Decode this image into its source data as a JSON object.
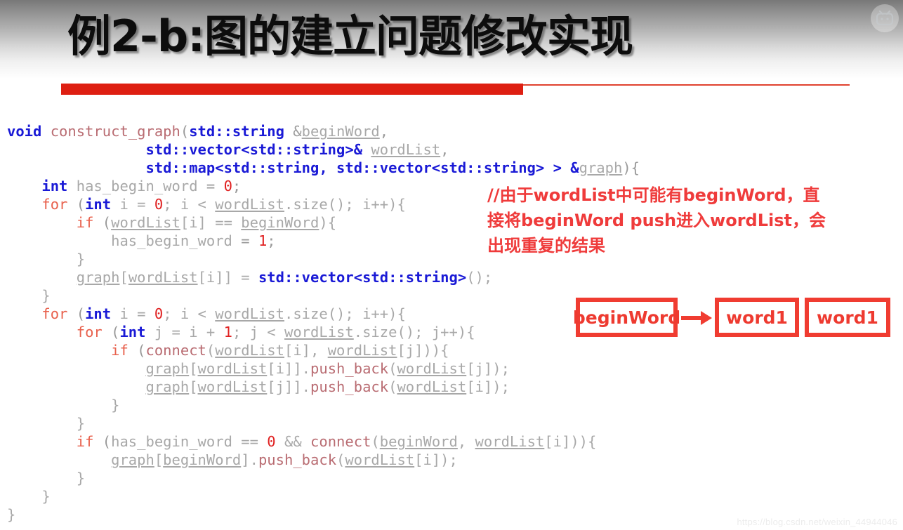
{
  "slide": {
    "title": "例2-b:图的建立问题修改实现",
    "watermark": "https://blog.csdn.net/weixin_44944046",
    "logo_icon": "bilibili-tv-logo-icon",
    "accent_color": "#de1f12",
    "annotation_color": "#ef3b3b",
    "keyword_color": "#1a1ad6"
  },
  "code": {
    "language": "cpp",
    "lines": [
      {
        "indent": 0,
        "tokens": [
          {
            "t": "void",
            "c": "kw"
          },
          {
            "t": " ",
            "c": "punc"
          },
          {
            "t": "construct_graph",
            "c": "fn"
          },
          {
            "t": "(",
            "c": "punc"
          },
          {
            "t": "std::string",
            "c": "kw"
          },
          {
            "t": " &",
            "c": "punc"
          },
          {
            "t": "beginWord",
            "c": "var"
          },
          {
            "t": ",",
            "c": "punc"
          }
        ]
      },
      {
        "indent": 8,
        "tokens": [
          {
            "t": "std::vector",
            "c": "kw"
          },
          {
            "t": "<",
            "c": "kw"
          },
          {
            "t": "std::string",
            "c": "kw"
          },
          {
            "t": ">& ",
            "c": "kw"
          },
          {
            "t": "wordList",
            "c": "var"
          },
          {
            "t": ",",
            "c": "punc"
          }
        ]
      },
      {
        "indent": 8,
        "tokens": [
          {
            "t": "std::map",
            "c": "kw"
          },
          {
            "t": "<",
            "c": "kw"
          },
          {
            "t": "std::string",
            "c": "kw"
          },
          {
            "t": ", ",
            "c": "kw"
          },
          {
            "t": "std::vector",
            "c": "kw"
          },
          {
            "t": "<",
            "c": "kw"
          },
          {
            "t": "std::string",
            "c": "kw"
          },
          {
            "t": "> > &",
            "c": "kw"
          },
          {
            "t": "graph",
            "c": "var"
          },
          {
            "t": "){",
            "c": "punc"
          }
        ]
      },
      {
        "indent": 2,
        "tokens": [
          {
            "t": "int",
            "c": "kw"
          },
          {
            "t": " ",
            "c": "punc"
          },
          {
            "t": "has_begin_word",
            "c": "id"
          },
          {
            "t": " = ",
            "c": "punc"
          },
          {
            "t": "0",
            "c": "num"
          },
          {
            "t": ";",
            "c": "punc"
          }
        ]
      },
      {
        "indent": 2,
        "tokens": [
          {
            "t": "for",
            "c": "ctl"
          },
          {
            "t": " (",
            "c": "punc"
          },
          {
            "t": "int",
            "c": "kw"
          },
          {
            "t": " i = ",
            "c": "id"
          },
          {
            "t": "0",
            "c": "num"
          },
          {
            "t": "; i < ",
            "c": "id"
          },
          {
            "t": "wordList",
            "c": "var"
          },
          {
            "t": ".size(); i++){",
            "c": "id"
          }
        ]
      },
      {
        "indent": 4,
        "tokens": [
          {
            "t": "if",
            "c": "ctl"
          },
          {
            "t": " (",
            "c": "punc"
          },
          {
            "t": "wordList",
            "c": "var"
          },
          {
            "t": "[i] == ",
            "c": "id"
          },
          {
            "t": "beginWord",
            "c": "var"
          },
          {
            "t": "){",
            "c": "id"
          }
        ]
      },
      {
        "indent": 6,
        "tokens": [
          {
            "t": "has_begin_word",
            "c": "id"
          },
          {
            "t": " = ",
            "c": "punc"
          },
          {
            "t": "1",
            "c": "num"
          },
          {
            "t": ";",
            "c": "punc"
          }
        ]
      },
      {
        "indent": 4,
        "tokens": [
          {
            "t": "}",
            "c": "id"
          }
        ]
      },
      {
        "indent": 4,
        "tokens": [
          {
            "t": "graph",
            "c": "var"
          },
          {
            "t": "[",
            "c": "id"
          },
          {
            "t": "wordList",
            "c": "var"
          },
          {
            "t": "[i]] = ",
            "c": "id"
          },
          {
            "t": "std::vector",
            "c": "kw"
          },
          {
            "t": "<",
            "c": "kw"
          },
          {
            "t": "std::string",
            "c": "kw"
          },
          {
            "t": ">",
            "c": "kw"
          },
          {
            "t": "();",
            "c": "id"
          }
        ]
      },
      {
        "indent": 2,
        "tokens": [
          {
            "t": "}",
            "c": "id"
          }
        ]
      },
      {
        "indent": 2,
        "tokens": [
          {
            "t": "for",
            "c": "ctl"
          },
          {
            "t": " (",
            "c": "punc"
          },
          {
            "t": "int",
            "c": "kw"
          },
          {
            "t": " i = ",
            "c": "id"
          },
          {
            "t": "0",
            "c": "num"
          },
          {
            "t": "; i < ",
            "c": "id"
          },
          {
            "t": "wordList",
            "c": "var"
          },
          {
            "t": ".size(); i++){",
            "c": "id"
          }
        ]
      },
      {
        "indent": 4,
        "tokens": [
          {
            "t": "for",
            "c": "ctl"
          },
          {
            "t": " (",
            "c": "punc"
          },
          {
            "t": "int",
            "c": "kw"
          },
          {
            "t": " j = i + ",
            "c": "id"
          },
          {
            "t": "1",
            "c": "num"
          },
          {
            "t": "; j < ",
            "c": "id"
          },
          {
            "t": "wordList",
            "c": "var"
          },
          {
            "t": ".size(); j++){",
            "c": "id"
          }
        ]
      },
      {
        "indent": 6,
        "tokens": [
          {
            "t": "if",
            "c": "ctl"
          },
          {
            "t": " (",
            "c": "punc"
          },
          {
            "t": "connect",
            "c": "fn"
          },
          {
            "t": "(",
            "c": "id"
          },
          {
            "t": "wordList",
            "c": "var"
          },
          {
            "t": "[i], ",
            "c": "id"
          },
          {
            "t": "wordList",
            "c": "var"
          },
          {
            "t": "[j])){",
            "c": "id"
          }
        ]
      },
      {
        "indent": 8,
        "tokens": [
          {
            "t": "graph",
            "c": "var"
          },
          {
            "t": "[",
            "c": "id"
          },
          {
            "t": "wordList",
            "c": "var"
          },
          {
            "t": "[i]].",
            "c": "id"
          },
          {
            "t": "push_back",
            "c": "fn"
          },
          {
            "t": "(",
            "c": "id"
          },
          {
            "t": "wordList",
            "c": "var"
          },
          {
            "t": "[j]);",
            "c": "id"
          }
        ]
      },
      {
        "indent": 8,
        "tokens": [
          {
            "t": "graph",
            "c": "var"
          },
          {
            "t": "[",
            "c": "id"
          },
          {
            "t": "wordList",
            "c": "var"
          },
          {
            "t": "[j]].",
            "c": "id"
          },
          {
            "t": "push_back",
            "c": "fn"
          },
          {
            "t": "(",
            "c": "id"
          },
          {
            "t": "wordList",
            "c": "var"
          },
          {
            "t": "[i]);",
            "c": "id"
          }
        ]
      },
      {
        "indent": 6,
        "tokens": [
          {
            "t": "}",
            "c": "id"
          }
        ]
      },
      {
        "indent": 4,
        "tokens": [
          {
            "t": "}",
            "c": "id"
          }
        ]
      },
      {
        "indent": 4,
        "tokens": [
          {
            "t": "if",
            "c": "ctl"
          },
          {
            "t": " (",
            "c": "punc"
          },
          {
            "t": "has_begin_word",
            "c": "id"
          },
          {
            "t": " == ",
            "c": "id"
          },
          {
            "t": "0",
            "c": "num"
          },
          {
            "t": " && ",
            "c": "id"
          },
          {
            "t": "connect",
            "c": "fn"
          },
          {
            "t": "(",
            "c": "id"
          },
          {
            "t": "beginWord",
            "c": "var"
          },
          {
            "t": ", ",
            "c": "id"
          },
          {
            "t": "wordList",
            "c": "var"
          },
          {
            "t": "[i])){",
            "c": "id"
          }
        ]
      },
      {
        "indent": 6,
        "tokens": [
          {
            "t": "graph",
            "c": "var"
          },
          {
            "t": "[",
            "c": "id"
          },
          {
            "t": "beginWord",
            "c": "var"
          },
          {
            "t": "].",
            "c": "id"
          },
          {
            "t": "push_back",
            "c": "fn"
          },
          {
            "t": "(",
            "c": "id"
          },
          {
            "t": "wordList",
            "c": "var"
          },
          {
            "t": "[i]);",
            "c": "id"
          }
        ]
      },
      {
        "indent": 4,
        "tokens": [
          {
            "t": "}",
            "c": "id"
          }
        ]
      },
      {
        "indent": 2,
        "tokens": [
          {
            "t": "}",
            "c": "id"
          }
        ]
      },
      {
        "indent": 0,
        "tokens": [
          {
            "t": "}",
            "c": "id"
          }
        ]
      }
    ]
  },
  "annotation": {
    "lines": [
      "//由于wordList中可能有beginWord，直",
      "接将beginWord push进入wordList，会",
      "出现重复的结果"
    ]
  },
  "diagram": {
    "boxes": [
      {
        "label": "beginWord"
      },
      {
        "label": "word1"
      },
      {
        "label": "word1"
      }
    ],
    "arrow_icon": "right-arrow-icon"
  }
}
